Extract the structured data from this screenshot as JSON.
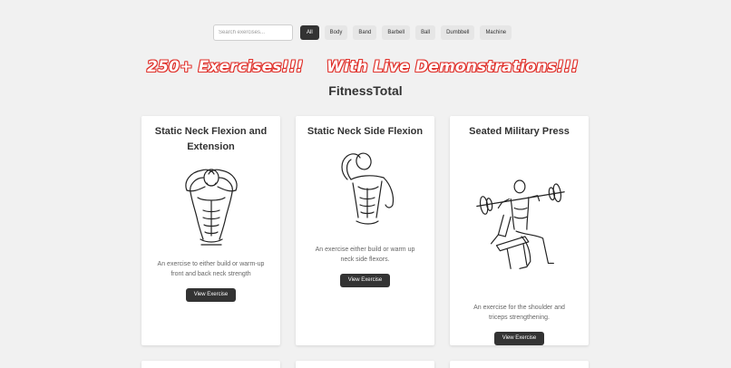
{
  "toolbar": {
    "search_placeholder": "Search exercises...",
    "filters": [
      "All",
      "Body",
      "Band",
      "Barbell",
      "Ball",
      "Dumbbell",
      "Machine"
    ],
    "active_filter": "All"
  },
  "banner": {
    "left": "250+ Exercises!!!",
    "right": "With Live Demonstrations!!!",
    "color": "#e0312b"
  },
  "site_title": "FitnessTotal",
  "cards": [
    {
      "title": "Static Neck Flexion and Extension",
      "description": "An exercise to either build or warm-up front and back neck strength",
      "button": "View Exercise",
      "illustration": "neck-flexion-extension-illustration"
    },
    {
      "title": "Static Neck Side Flexion",
      "description": "An exercise either build or warm up neck side flexors.",
      "button": "View Exercise",
      "illustration": "neck-side-flexion-illustration"
    },
    {
      "title": "Seated Military Press",
      "description": "An exercise for the shoulder and triceps strengthening.",
      "button": "View Exercise",
      "illustration": "seated-military-press-illustration"
    }
  ]
}
